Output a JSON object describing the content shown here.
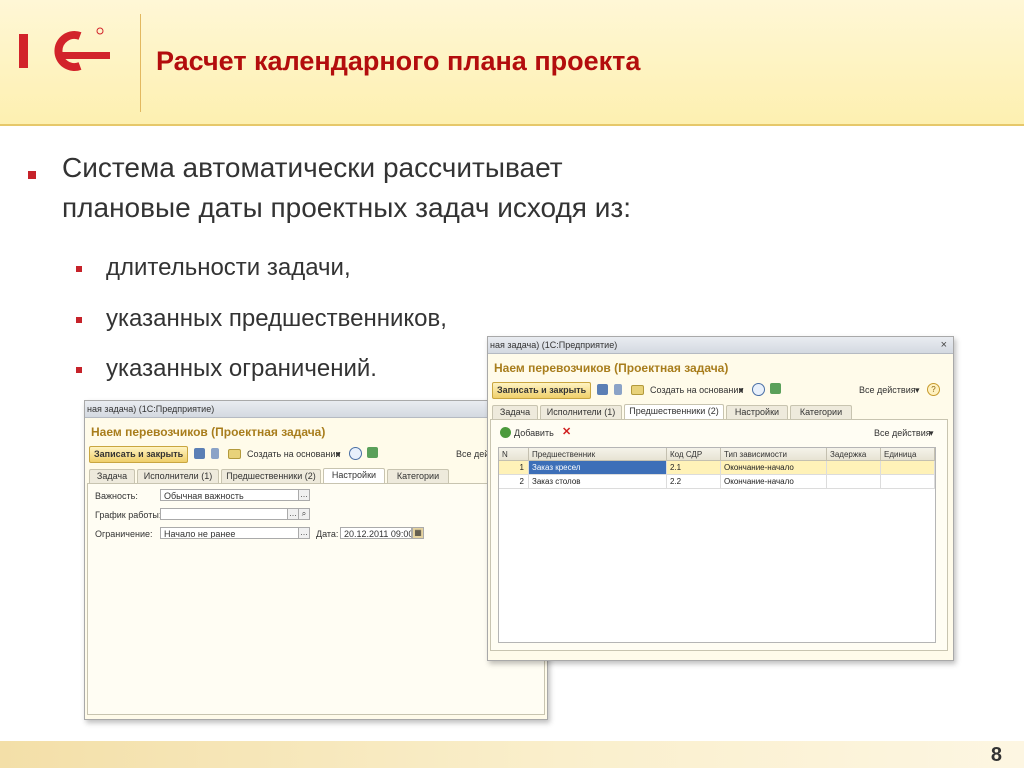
{
  "slide": {
    "title": "Расчет календарного плана проекта",
    "page_number": "8",
    "brand_color": "#b30d0d",
    "bullet_color": "#c6222a"
  },
  "content": {
    "main_bullet_line1": "Система автоматически рассчитывает",
    "main_bullet_line2": "плановые даты проектных задач исходя из:",
    "sub_bullets": [
      "длительности задачи,",
      "указанных предшественников,",
      "указанных ограничений."
    ]
  },
  "window_back": {
    "title_bar": "ная задача) (1С:Предприятие)",
    "form_title": "Наем перевозчиков (Проектная задача)",
    "toolbar": {
      "save_close": "Записать и закрыть",
      "create_based": "Создать на основании",
      "all_actions": "Все действ"
    },
    "tabs": [
      "Задача",
      "Исполнители (1)",
      "Предшественники (2)",
      "Настройки",
      "Категории"
    ],
    "active_tab": "Настройки",
    "fields": {
      "importance_label": "Важность:",
      "importance_value": "Обычная важность",
      "schedule_label": "График работы:",
      "schedule_value": "",
      "constraint_label": "Ограничение:",
      "constraint_value": "Начало не ранее",
      "date_label": "Дата:",
      "date_value": "20.12.2011 09:00"
    }
  },
  "window_front": {
    "title_bar": "ная задача) (1С:Предприятие)",
    "close": "×",
    "form_title": "Наем перевозчиков (Проектная задача)",
    "toolbar": {
      "save_close": "Записать и закрыть",
      "create_based": "Создать на основании",
      "all_actions": "Все действия",
      "help": "?"
    },
    "tabs": [
      "Задача",
      "Исполнители (1)",
      "Предшественники (2)",
      "Настройки",
      "Категории"
    ],
    "active_tab": "Предшественники (2)",
    "grid_toolbar": {
      "add": "Добавить",
      "all_actions": "Все действия"
    },
    "grid": {
      "columns": [
        "N",
        "Предшественник",
        "Код СДР",
        "Тип зависимости",
        "Задержка",
        "Единица"
      ],
      "rows": [
        {
          "n": "1",
          "predecessor": "Заказ кресел",
          "code": "2.1",
          "type": "Окончание-начало",
          "delay": "",
          "unit": ""
        },
        {
          "n": "2",
          "predecessor": "Заказ столов",
          "code": "2.2",
          "type": "Окончание-начало",
          "delay": "",
          "unit": ""
        }
      ]
    }
  },
  "icons": [
    "1c-logo",
    "save-icon",
    "post-icon",
    "mail-icon",
    "dropdown-arrow-icon",
    "clock-icon",
    "structure-icon",
    "add-icon",
    "delete-icon",
    "help-icon",
    "calendar-icon",
    "search-icon"
  ]
}
